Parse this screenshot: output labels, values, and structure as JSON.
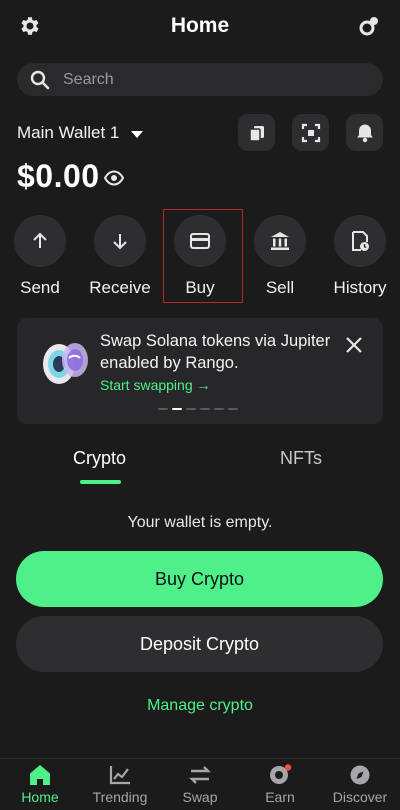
{
  "header": {
    "title": "Home"
  },
  "search": {
    "placeholder": "Search"
  },
  "wallet": {
    "name": "Main Wallet 1",
    "balance": "$0.00"
  },
  "actions": [
    {
      "label": "Send",
      "icon": "arrow-up-icon"
    },
    {
      "label": "Receive",
      "icon": "arrow-down-icon"
    },
    {
      "label": "Buy",
      "icon": "card-icon"
    },
    {
      "label": "Sell",
      "icon": "bank-icon"
    },
    {
      "label": "History",
      "icon": "history-icon"
    }
  ],
  "promo": {
    "text": "Swap Solana tokens via Jupiter enabled by Rango.",
    "link": "Start swapping →",
    "page_index": 1,
    "page_count": 6
  },
  "tabs": {
    "crypto": "Crypto",
    "nfts": "NFTs",
    "active": "Crypto"
  },
  "empty_message": "Your wallet is empty.",
  "buttons": {
    "buy_crypto": "Buy Crypto",
    "deposit_crypto": "Deposit Crypto",
    "manage_crypto": "Manage crypto"
  },
  "nav": [
    {
      "label": "Home",
      "icon": "home-icon",
      "active": true
    },
    {
      "label": "Trending",
      "icon": "trending-icon"
    },
    {
      "label": "Swap",
      "icon": "swap-icon"
    },
    {
      "label": "Earn",
      "icon": "earn-icon",
      "badge": true
    },
    {
      "label": "Discover",
      "icon": "compass-icon"
    }
  ],
  "colors": {
    "accent": "#4ff08a",
    "background": "#1b1b1c",
    "surface": "#2e2e30",
    "highlight": "#b52a2a"
  }
}
